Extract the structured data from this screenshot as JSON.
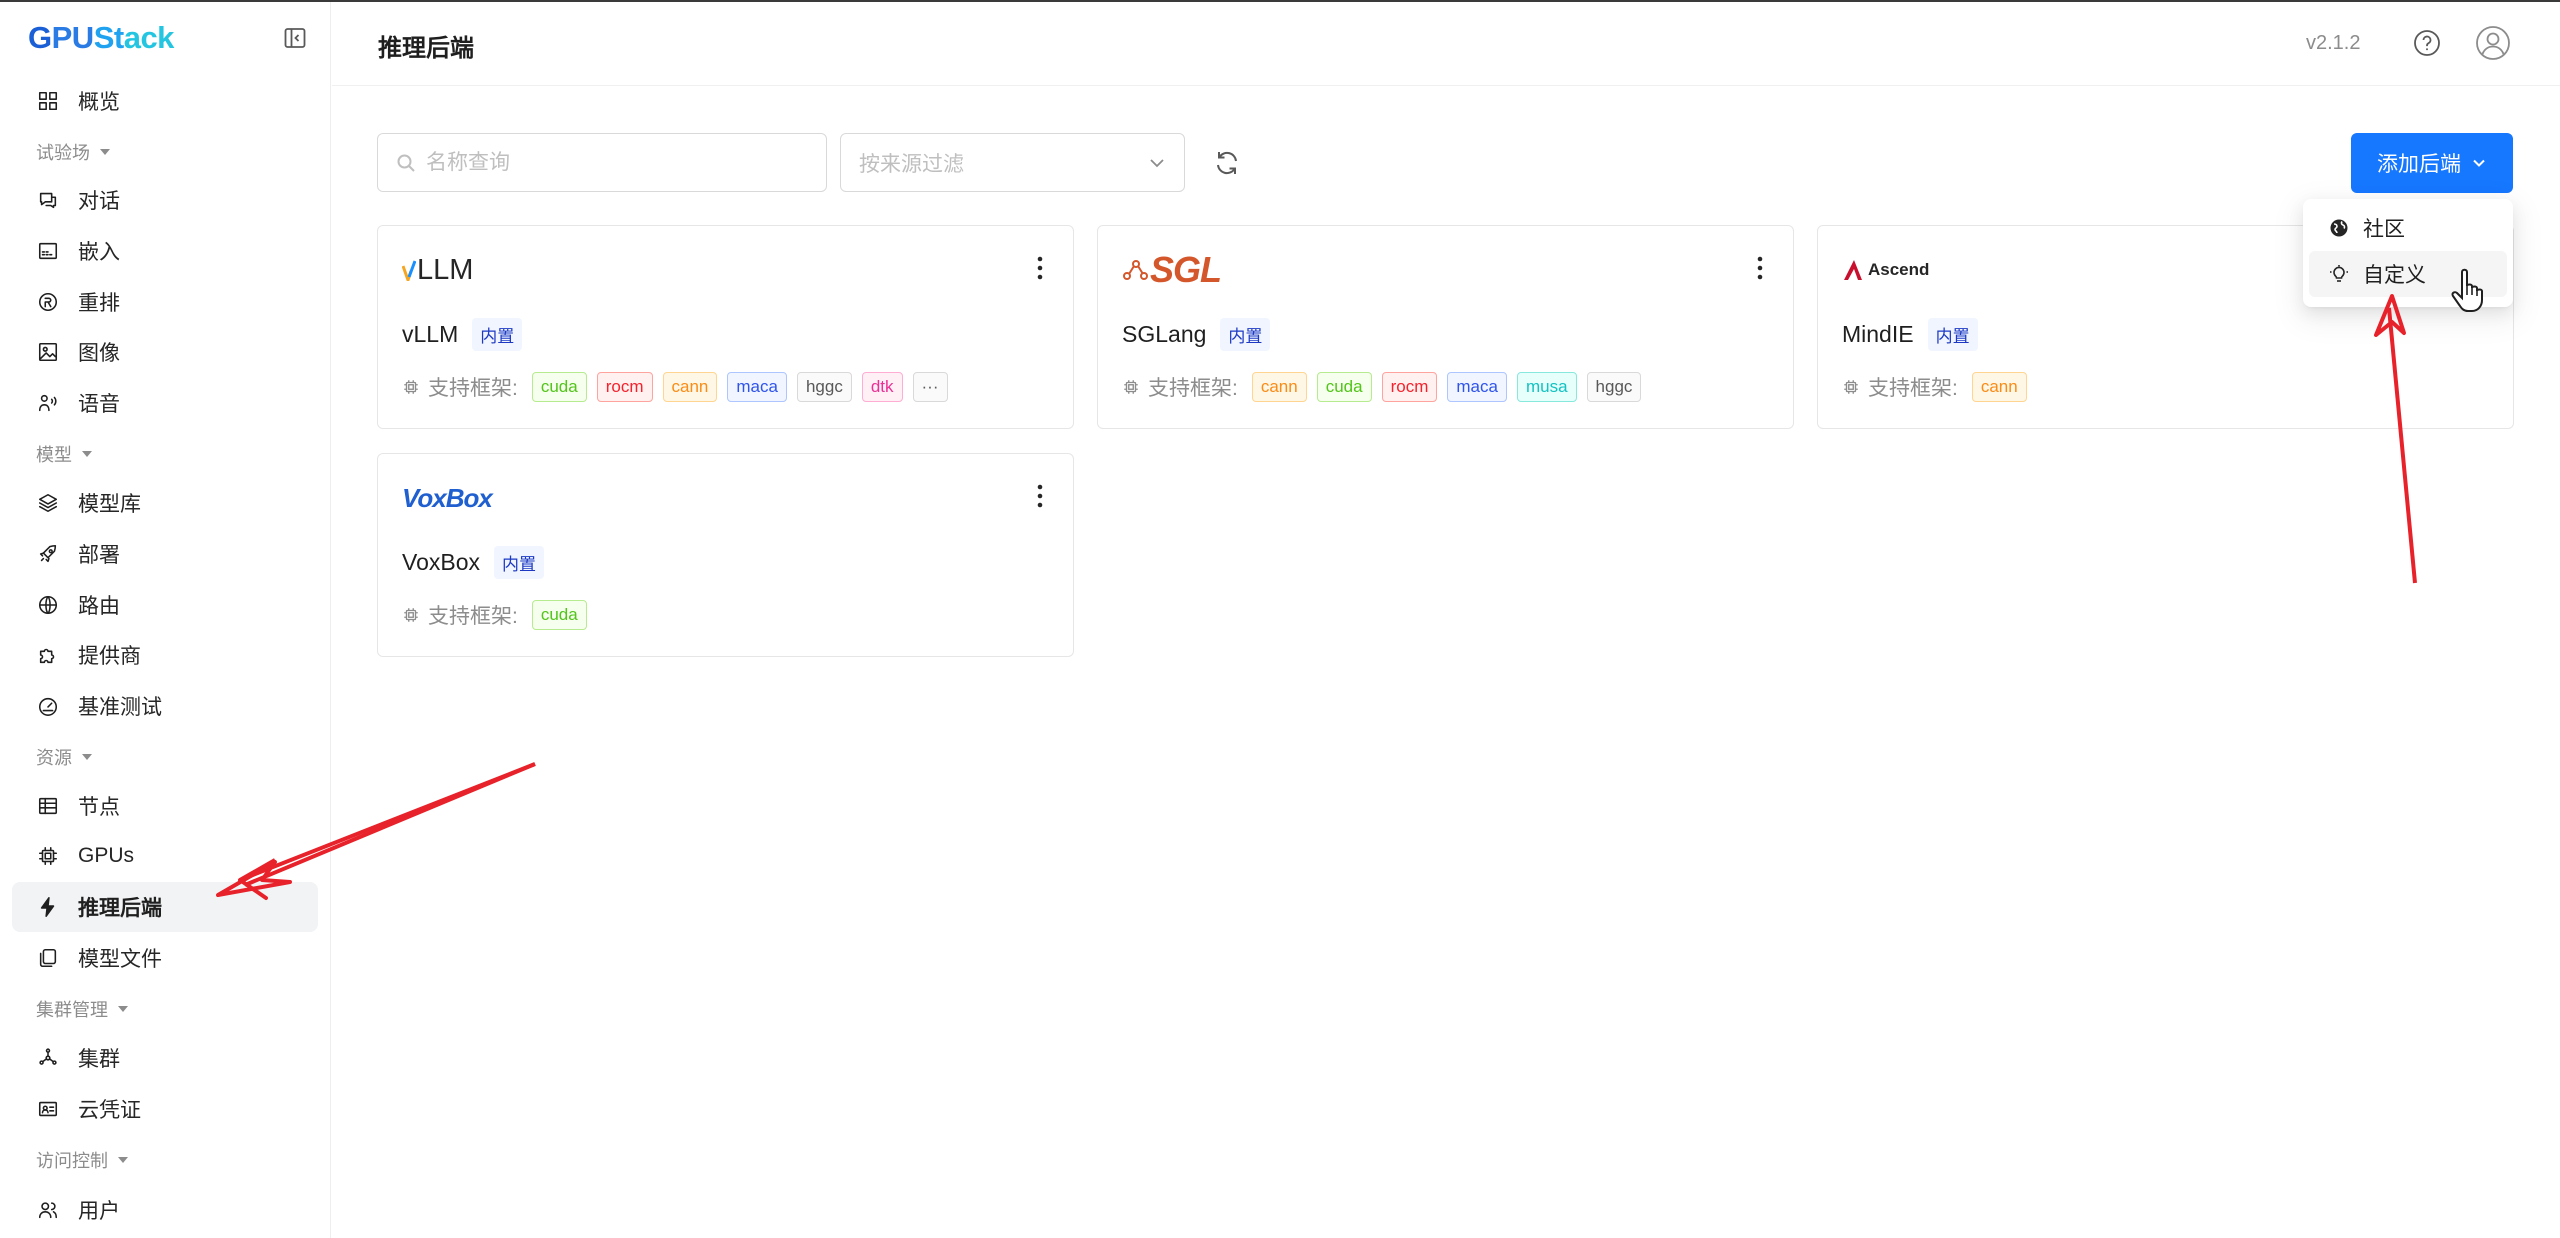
{
  "app": {
    "logo_g": "G",
    "logo_pu": "PU",
    "logo_st": "St",
    "logo_ck": "ack"
  },
  "sidebar": {
    "items": [
      {
        "label": "概览",
        "icon": "grid-icon"
      },
      {
        "group": "试验场"
      },
      {
        "label": "对话",
        "icon": "chat-icon"
      },
      {
        "label": "嵌入",
        "icon": "embed-icon"
      },
      {
        "label": "重排",
        "icon": "rerank-icon"
      },
      {
        "label": "图像",
        "icon": "image-icon"
      },
      {
        "label": "语音",
        "icon": "voice-icon"
      },
      {
        "group": "模型"
      },
      {
        "label": "模型库",
        "icon": "layers-icon"
      },
      {
        "label": "部署",
        "icon": "rocket-icon"
      },
      {
        "label": "路由",
        "icon": "globe-icon"
      },
      {
        "label": "提供商",
        "icon": "puzzle-icon"
      },
      {
        "label": "基准测试",
        "icon": "gauge-icon"
      },
      {
        "group": "资源"
      },
      {
        "label": "节点",
        "icon": "server-icon"
      },
      {
        "label": "GPUs",
        "icon": "chip-icon"
      },
      {
        "label": "推理后端",
        "icon": "bolt-icon",
        "active": true
      },
      {
        "label": "模型文件",
        "icon": "files-icon"
      },
      {
        "group": "集群管理"
      },
      {
        "label": "集群",
        "icon": "cluster-icon"
      },
      {
        "label": "云凭证",
        "icon": "id-card-icon"
      },
      {
        "group": "访问控制"
      },
      {
        "label": "用户",
        "icon": "users-icon"
      }
    ]
  },
  "header": {
    "title": "推理后端",
    "version": "v2.1.2"
  },
  "toolbar": {
    "search_placeholder": "名称查询",
    "filter_placeholder": "按来源过滤",
    "add_label": "添加后端"
  },
  "dropdown": {
    "items": [
      {
        "label": "社区",
        "icon": "globe-filled-icon"
      },
      {
        "label": "自定义",
        "icon": "bulb-icon"
      }
    ]
  },
  "cards": [
    {
      "logo": "vLLM",
      "name": "vLLM",
      "badge": "内置",
      "fw_label": "支持框架:",
      "frameworks": [
        {
          "name": "cuda",
          "color": "green"
        },
        {
          "name": "rocm",
          "color": "red"
        },
        {
          "name": "cann",
          "color": "orange"
        },
        {
          "name": "maca",
          "color": "blue"
        },
        {
          "name": "hggc",
          "color": "gray"
        },
        {
          "name": "dtk",
          "color": "magenta"
        },
        {
          "name": "···",
          "color": "gray"
        }
      ]
    },
    {
      "logo": "SGL",
      "name": "SGLang",
      "badge": "内置",
      "fw_label": "支持框架:",
      "frameworks": [
        {
          "name": "cann",
          "color": "orange"
        },
        {
          "name": "cuda",
          "color": "green"
        },
        {
          "name": "rocm",
          "color": "red"
        },
        {
          "name": "maca",
          "color": "blue"
        },
        {
          "name": "musa",
          "color": "cyan"
        },
        {
          "name": "hggc",
          "color": "gray"
        }
      ]
    },
    {
      "logo": "Ascend",
      "name": "MindIE",
      "badge": "内置",
      "fw_label": "支持框架:",
      "frameworks": [
        {
          "name": "cann",
          "color": "orange"
        }
      ]
    },
    {
      "logo": "VoxBox",
      "name": "VoxBox",
      "badge": "内置",
      "fw_label": "支持框架:",
      "frameworks": [
        {
          "name": "cuda",
          "color": "green"
        }
      ]
    }
  ],
  "colors": {
    "primary": "#1677ff",
    "arrow": "#e8222a"
  }
}
